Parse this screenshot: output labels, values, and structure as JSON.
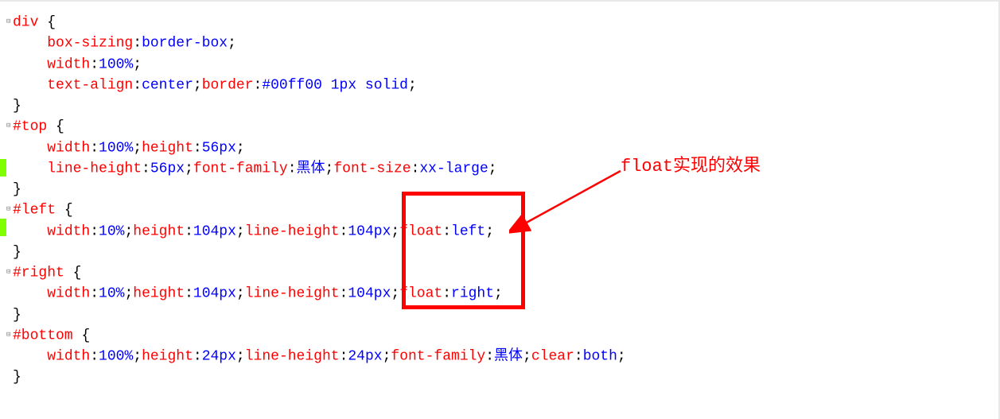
{
  "annotation": {
    "label": "float实现的效果"
  },
  "code": {
    "rules": [
      {
        "selector": "div",
        "open": "{",
        "decls": [
          [
            {
              "t": "property",
              "v": "box-sizing"
            },
            {
              "t": "punct",
              "v": ":"
            },
            {
              "t": "value",
              "v": "border-box"
            },
            {
              "t": "punct",
              "v": ";"
            }
          ],
          [
            {
              "t": "property",
              "v": "width"
            },
            {
              "t": "punct",
              "v": ":"
            },
            {
              "t": "value",
              "v": "100%"
            },
            {
              "t": "punct",
              "v": ";"
            }
          ],
          [
            {
              "t": "property",
              "v": "text-align"
            },
            {
              "t": "punct",
              "v": ":"
            },
            {
              "t": "value",
              "v": "center"
            },
            {
              "t": "punct",
              "v": ";"
            },
            {
              "t": "property",
              "v": "border"
            },
            {
              "t": "punct",
              "v": ":"
            },
            {
              "t": "value",
              "v": "#00ff00 1px solid"
            },
            {
              "t": "punct",
              "v": ";"
            }
          ]
        ],
        "close": "}"
      },
      {
        "selector": "#top",
        "open": "{",
        "decls": [
          [
            {
              "t": "property",
              "v": "width"
            },
            {
              "t": "punct",
              "v": ":"
            },
            {
              "t": "value",
              "v": "100%"
            },
            {
              "t": "punct",
              "v": ";"
            },
            {
              "t": "property",
              "v": "height"
            },
            {
              "t": "punct",
              "v": ":"
            },
            {
              "t": "value",
              "v": "56px"
            },
            {
              "t": "punct",
              "v": ";"
            }
          ],
          [
            {
              "t": "property",
              "v": "line-height"
            },
            {
              "t": "punct",
              "v": ":"
            },
            {
              "t": "value",
              "v": "56px"
            },
            {
              "t": "punct",
              "v": ";"
            },
            {
              "t": "property",
              "v": "font-family"
            },
            {
              "t": "punct",
              "v": ":"
            },
            {
              "t": "value",
              "v": "黑体"
            },
            {
              "t": "punct",
              "v": ";"
            },
            {
              "t": "property",
              "v": "font-size"
            },
            {
              "t": "punct",
              "v": ":"
            },
            {
              "t": "value",
              "v": "xx-large"
            },
            {
              "t": "punct",
              "v": ";"
            }
          ]
        ],
        "close": "}"
      },
      {
        "selector": "#left",
        "open": "{",
        "decls": [
          [
            {
              "t": "property",
              "v": "width"
            },
            {
              "t": "punct",
              "v": ":"
            },
            {
              "t": "value",
              "v": "10%"
            },
            {
              "t": "punct",
              "v": ";"
            },
            {
              "t": "property",
              "v": "height"
            },
            {
              "t": "punct",
              "v": ":"
            },
            {
              "t": "value",
              "v": "104px"
            },
            {
              "t": "punct",
              "v": ";"
            },
            {
              "t": "property",
              "v": "line-height"
            },
            {
              "t": "punct",
              "v": ":"
            },
            {
              "t": "value",
              "v": "104px"
            },
            {
              "t": "punct",
              "v": ";"
            },
            {
              "t": "property",
              "v": "float"
            },
            {
              "t": "punct",
              "v": ":"
            },
            {
              "t": "value",
              "v": "left"
            },
            {
              "t": "punct",
              "v": ";"
            }
          ]
        ],
        "close": "}"
      },
      {
        "selector": "#right",
        "open": "{",
        "decls": [
          [
            {
              "t": "property",
              "v": "width"
            },
            {
              "t": "punct",
              "v": ":"
            },
            {
              "t": "value",
              "v": "10%"
            },
            {
              "t": "punct",
              "v": ";"
            },
            {
              "t": "property",
              "v": "height"
            },
            {
              "t": "punct",
              "v": ":"
            },
            {
              "t": "value",
              "v": "104px"
            },
            {
              "t": "punct",
              "v": ";"
            },
            {
              "t": "property",
              "v": "line-height"
            },
            {
              "t": "punct",
              "v": ":"
            },
            {
              "t": "value",
              "v": "104px"
            },
            {
              "t": "punct",
              "v": ";"
            },
            {
              "t": "property",
              "v": "float"
            },
            {
              "t": "punct",
              "v": ":"
            },
            {
              "t": "value",
              "v": "right"
            },
            {
              "t": "punct",
              "v": ";"
            }
          ]
        ],
        "close": "}"
      },
      {
        "selector": "#bottom",
        "open": "{",
        "decls": [
          [
            {
              "t": "property",
              "v": "width"
            },
            {
              "t": "punct",
              "v": ":"
            },
            {
              "t": "value",
              "v": "100%"
            },
            {
              "t": "punct",
              "v": ";"
            },
            {
              "t": "property",
              "v": "height"
            },
            {
              "t": "punct",
              "v": ":"
            },
            {
              "t": "value",
              "v": "24px"
            },
            {
              "t": "punct",
              "v": ";"
            },
            {
              "t": "property",
              "v": "line-height"
            },
            {
              "t": "punct",
              "v": ":"
            },
            {
              "t": "value",
              "v": "24px"
            },
            {
              "t": "punct",
              "v": ";"
            },
            {
              "t": "property",
              "v": "font-family"
            },
            {
              "t": "punct",
              "v": ":"
            },
            {
              "t": "value",
              "v": "黑体"
            },
            {
              "t": "punct",
              "v": ";"
            },
            {
              "t": "property",
              "v": "clear"
            },
            {
              "t": "punct",
              "v": ":"
            },
            {
              "t": "value",
              "v": "both"
            },
            {
              "t": "punct",
              "v": ";"
            }
          ]
        ],
        "close": "}"
      }
    ],
    "foldGlyph": "⊟",
    "indent": "    "
  }
}
